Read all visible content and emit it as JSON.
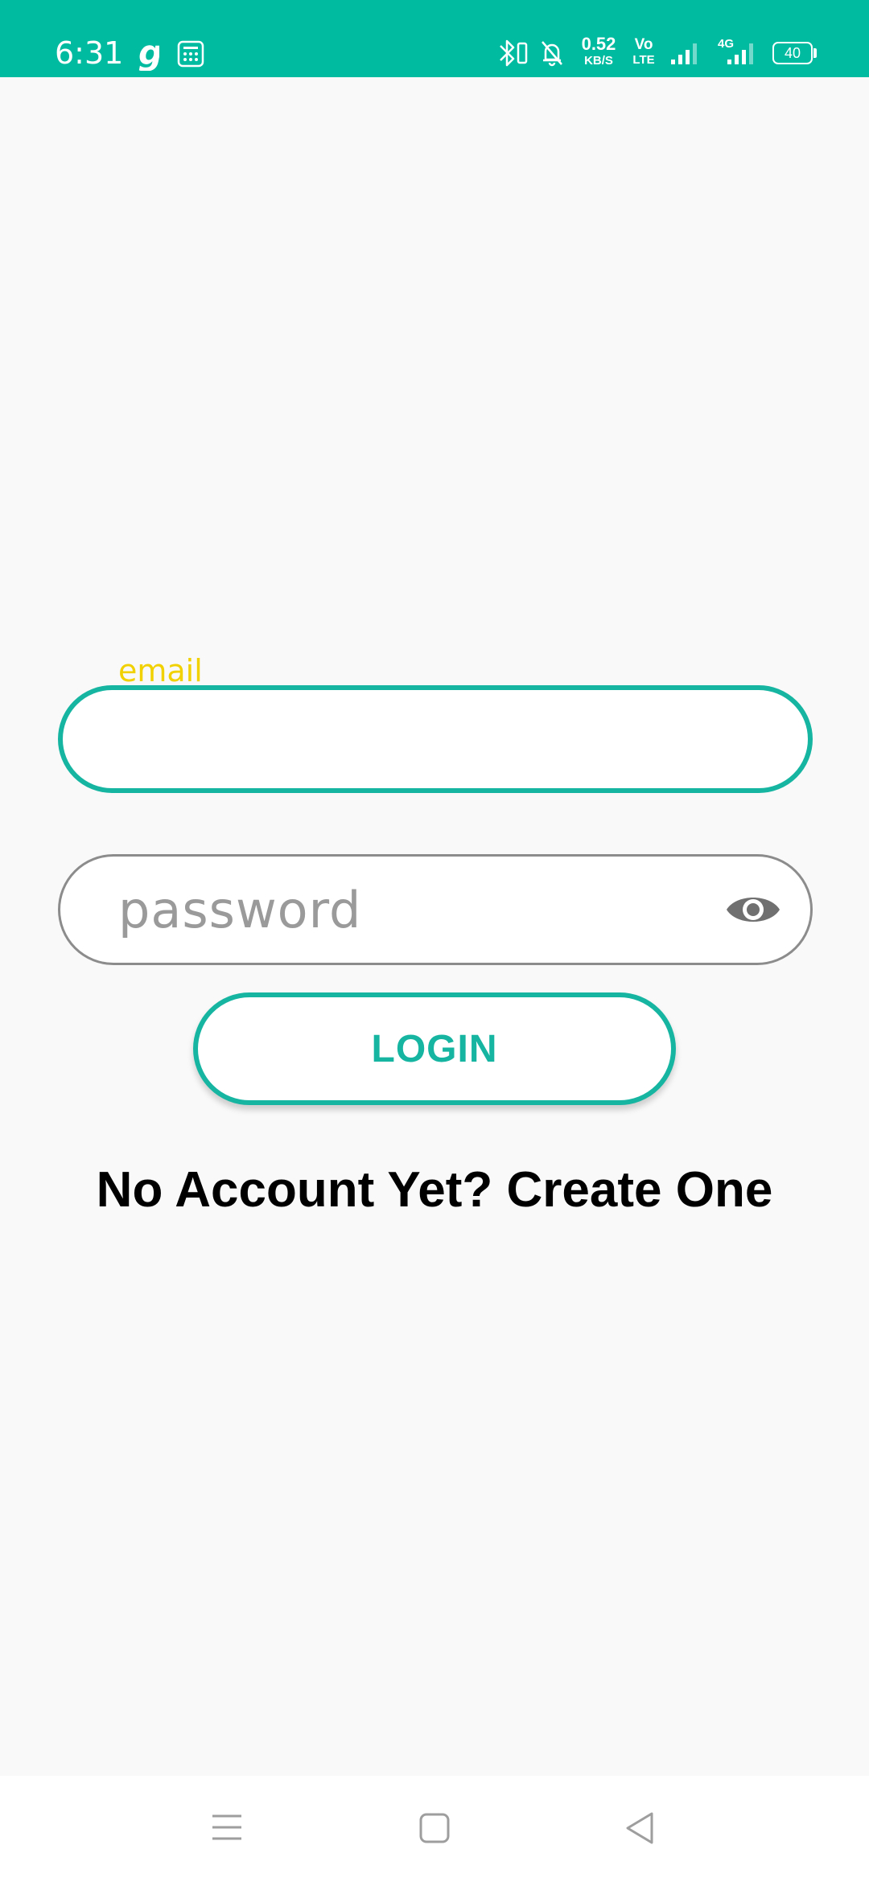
{
  "status_bar": {
    "time": "6:31",
    "network_speed_value": "0.52",
    "network_speed_unit": "KB/S",
    "volte_top": "Vo",
    "volte_bottom": "LTE",
    "network_type": "4G",
    "battery_level": "40",
    "icons": [
      "gaana-g-icon",
      "calculator-icon",
      "bluetooth-icon",
      "notifications-off-icon",
      "signal-icon",
      "signal-4g-icon",
      "battery-icon"
    ]
  },
  "login_form": {
    "email_label": "email",
    "email_value": "",
    "password_placeholder": "password",
    "password_toggle_icon": "eye-icon",
    "login_button_label": "LOGIN",
    "create_account_text": "No Account Yet? Create One"
  },
  "nav_bar": {
    "icons": [
      "menu-icon",
      "home-icon",
      "back-icon"
    ]
  },
  "colors": {
    "accent": "#16b5a2",
    "status_bar": "#00bba0",
    "email_label": "#f1d100",
    "background": "#f9f9f9"
  }
}
